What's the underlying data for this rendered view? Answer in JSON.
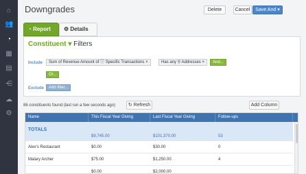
{
  "page": {
    "title": "Downgrades"
  },
  "actions": {
    "delete": "Delete",
    "cancel": "Cancel",
    "save_and": "Save And"
  },
  "tabs": {
    "report": "Report",
    "details": "Details"
  },
  "filter": {
    "title": "Constituent",
    "filters": "Filters",
    "include_label": "Include",
    "exclude_label": "Exclude",
    "chips": [
      {
        "text": "Sum of Revenue Amount of ",
        "icon": "info-icon",
        "text2": "Specific Transactions"
      },
      {
        "text": "Has any ",
        "icon": "pin-icon",
        "text2": "Addresses"
      }
    ],
    "and_button": "And...",
    "or_button": "Or...",
    "add_filter": "Add filter..."
  },
  "results": {
    "found_text": "86 constituents found (last run a few seconds ago)",
    "refresh": "Refresh",
    "add_column": "Add Column"
  },
  "table": {
    "columns": [
      "Name",
      "This Fiscal Year Giving",
      "Last Fiscal Year Giving",
      "Follow-ups"
    ],
    "totals": {
      "label": "TOTALS",
      "this_year": "$9,745.00",
      "last_year": "$101,370.00",
      "followups": "53"
    },
    "rows": [
      [
        "Alex's Restaurant",
        "$0.00",
        "$30.00",
        "0"
      ],
      [
        "Malary Archer",
        "$75.00",
        "$1,250.00",
        "4"
      ],
      [
        "",
        "$0.00",
        "$2,000.00",
        ""
      ]
    ]
  },
  "colors": {
    "green": "#72a82a",
    "blue": "#3f74b0",
    "sidebar": "#2f3440"
  }
}
